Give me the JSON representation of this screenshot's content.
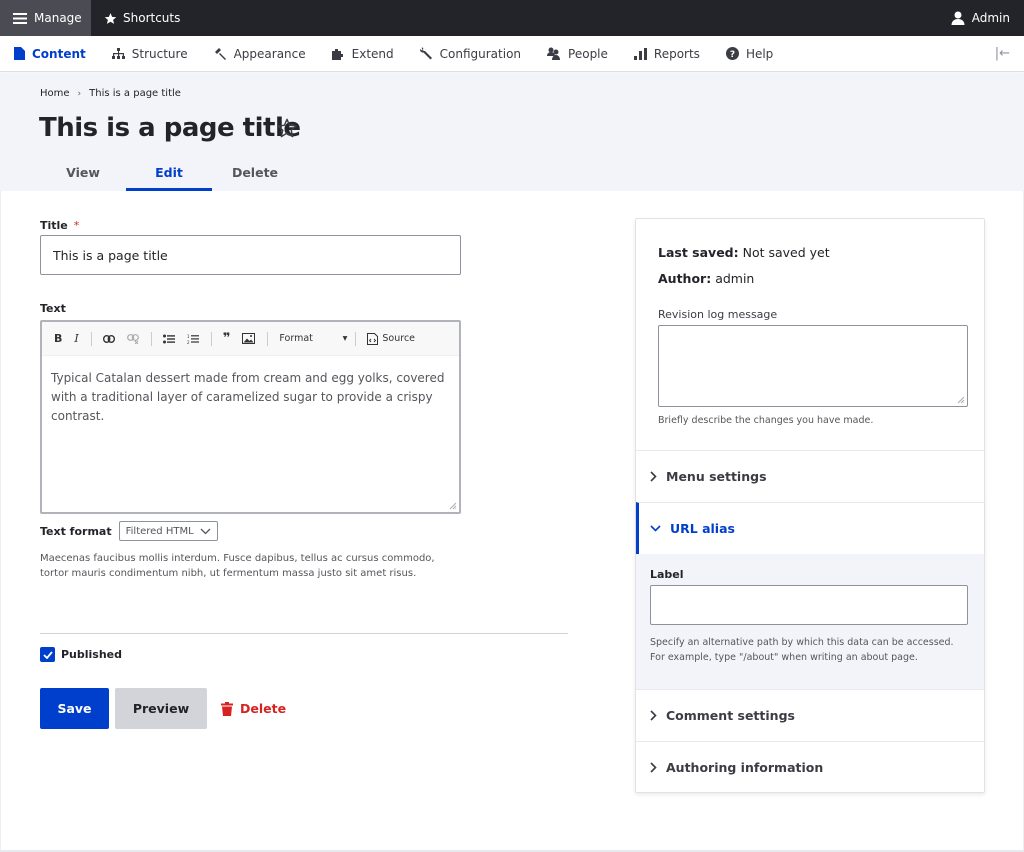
{
  "topbar": {
    "manage_label": "Manage",
    "shortcuts_label": "Shortcuts",
    "user_label": "Admin"
  },
  "toolbar": {
    "items": [
      {
        "label": "Content",
        "icon": "document-icon",
        "active": true
      },
      {
        "label": "Structure",
        "icon": "sitemap-icon",
        "active": false
      },
      {
        "label": "Appearance",
        "icon": "paint-icon",
        "active": false
      },
      {
        "label": "Extend",
        "icon": "puzzle-icon",
        "active": false
      },
      {
        "label": "Configuration",
        "icon": "wrench-icon",
        "active": false
      },
      {
        "label": "People",
        "icon": "people-icon",
        "active": false
      },
      {
        "label": "Reports",
        "icon": "bar-chart-icon",
        "active": false
      },
      {
        "label": "Help",
        "icon": "help-icon",
        "active": false
      }
    ],
    "collapse_glyph": "|←"
  },
  "header": {
    "breadcrumb": {
      "home": "Home",
      "separator": "›",
      "current": "This is a page title"
    },
    "title": "This is a page title",
    "tabs": [
      {
        "label": "View",
        "active": false
      },
      {
        "label": "Edit",
        "active": true
      },
      {
        "label": "Delete",
        "active": false
      }
    ]
  },
  "form": {
    "title_label": "Title",
    "required_mark": "*",
    "title_value": "This is a page title",
    "text_label": "Text",
    "editor": {
      "toolbar": {
        "bold": "B",
        "italic": "I",
        "blockquote": "❞",
        "format_label": "Format",
        "format_caret": "▾",
        "source_label": "Source"
      },
      "body": "Typical Catalan dessert made from cream and egg yolks, covered with a traditional layer of caramelized sugar to provide a crispy contrast."
    },
    "text_format_label": "Text format",
    "text_format_value": "Filtered HTML",
    "text_format_description": "Maecenas faucibus mollis interdum. Fusce dapibus, tellus ac cursus commodo, tortor mauris condimentum nibh, ut fermentum massa justo sit amet risus.",
    "published_label": "Published",
    "published_checked": true,
    "save_label": "Save",
    "preview_label": "Preview",
    "delete_label": "Delete"
  },
  "sidebar": {
    "last_saved_label": "Last saved:",
    "last_saved_value": "Not saved yet",
    "author_label": "Author:",
    "author_value": "admin",
    "revision_label": "Revision log message",
    "revision_value": "",
    "revision_description": "Briefly describe the changes you have made.",
    "accordions": [
      {
        "label": "Menu settings",
        "open": false
      },
      {
        "label": "URL alias",
        "open": true
      },
      {
        "label": "Comment settings",
        "open": false
      },
      {
        "label": "Authoring information",
        "open": false
      }
    ],
    "url_alias": {
      "field_label": "Label",
      "value": "",
      "description": "Specify an alternative path by which this data can be accessed. For example, type \"/about\" when writing an about page."
    }
  },
  "colors": {
    "accent": "#003ecc",
    "danger": "#d72222",
    "topbar": "#232429",
    "header_bg": "#f3f4f9"
  }
}
